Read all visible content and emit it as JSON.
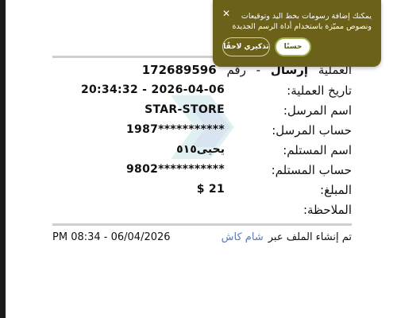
{
  "receipt": {
    "operation": {
      "label": "العملية",
      "type": "إرسال",
      "dash": "-",
      "number_label": "رقم",
      "number": "172689596"
    },
    "rows": [
      {
        "label": "تاريخ العملية:",
        "value": "20:34:32 - 2026-04-06"
      },
      {
        "label": "اسم المرسل:",
        "value": "STAR-STORE"
      },
      {
        "label": "حساب المرسل:",
        "value": "1987***********"
      },
      {
        "label": "اسم المستلم:",
        "value": "يحيى٥١٥"
      },
      {
        "label": "حساب المستلم:",
        "value": "9802***********"
      },
      {
        "label": "المبلغ:",
        "value": "$ 21"
      },
      {
        "label": "الملاحظة:",
        "value": ""
      }
    ],
    "footer": {
      "created_via": "تم إنشاء الملف عبر",
      "brand": "شام كاش",
      "timestamp": "PM 08:34 - 06/04/2026"
    }
  },
  "popup": {
    "message": "يمكنك إضافة رسومات بخط اليد وتوقيعات ونصوص مميّزة باستخدام أداة الرسم الجديدة",
    "ok_label": "حسنًا",
    "later_label": "تذكيري لاحقًا",
    "close_icon": "close-icon",
    "background_color": "#6b6119"
  }
}
